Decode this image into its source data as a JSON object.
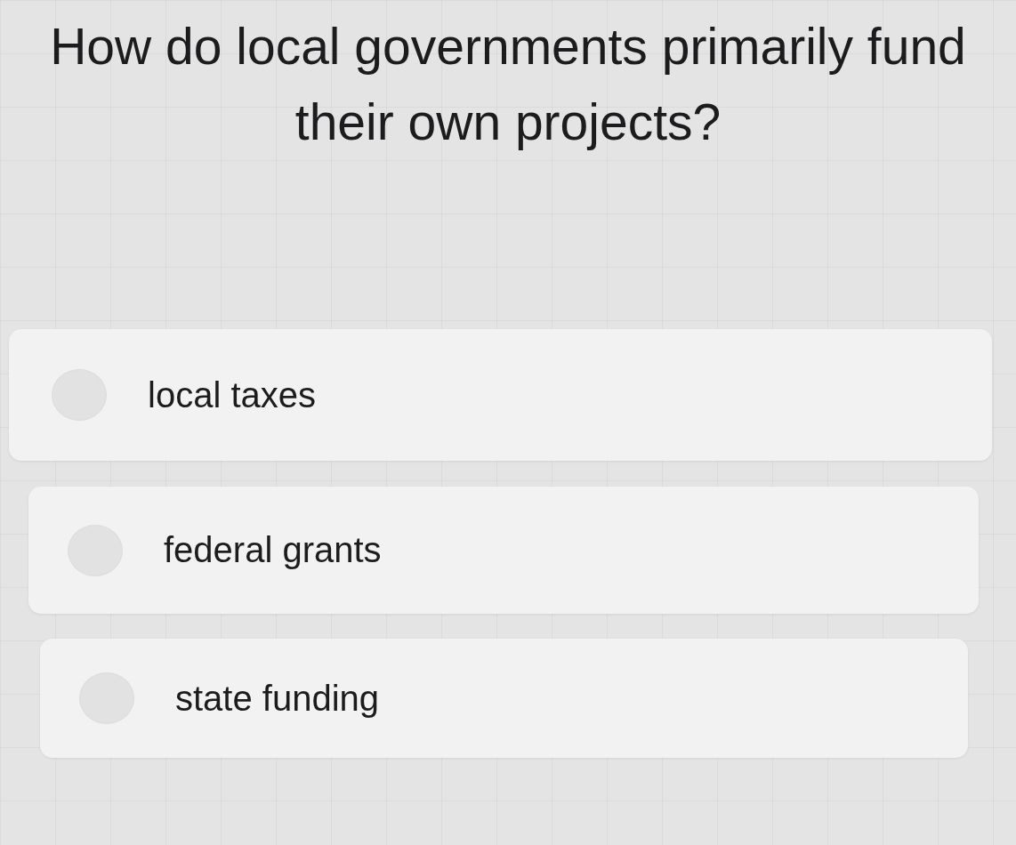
{
  "question": "How do local governments primarily fund their own projects?",
  "options": [
    {
      "label": "local taxes",
      "selected": false
    },
    {
      "label": "federal grants",
      "selected": false
    },
    {
      "label": "state funding",
      "selected": false
    }
  ]
}
